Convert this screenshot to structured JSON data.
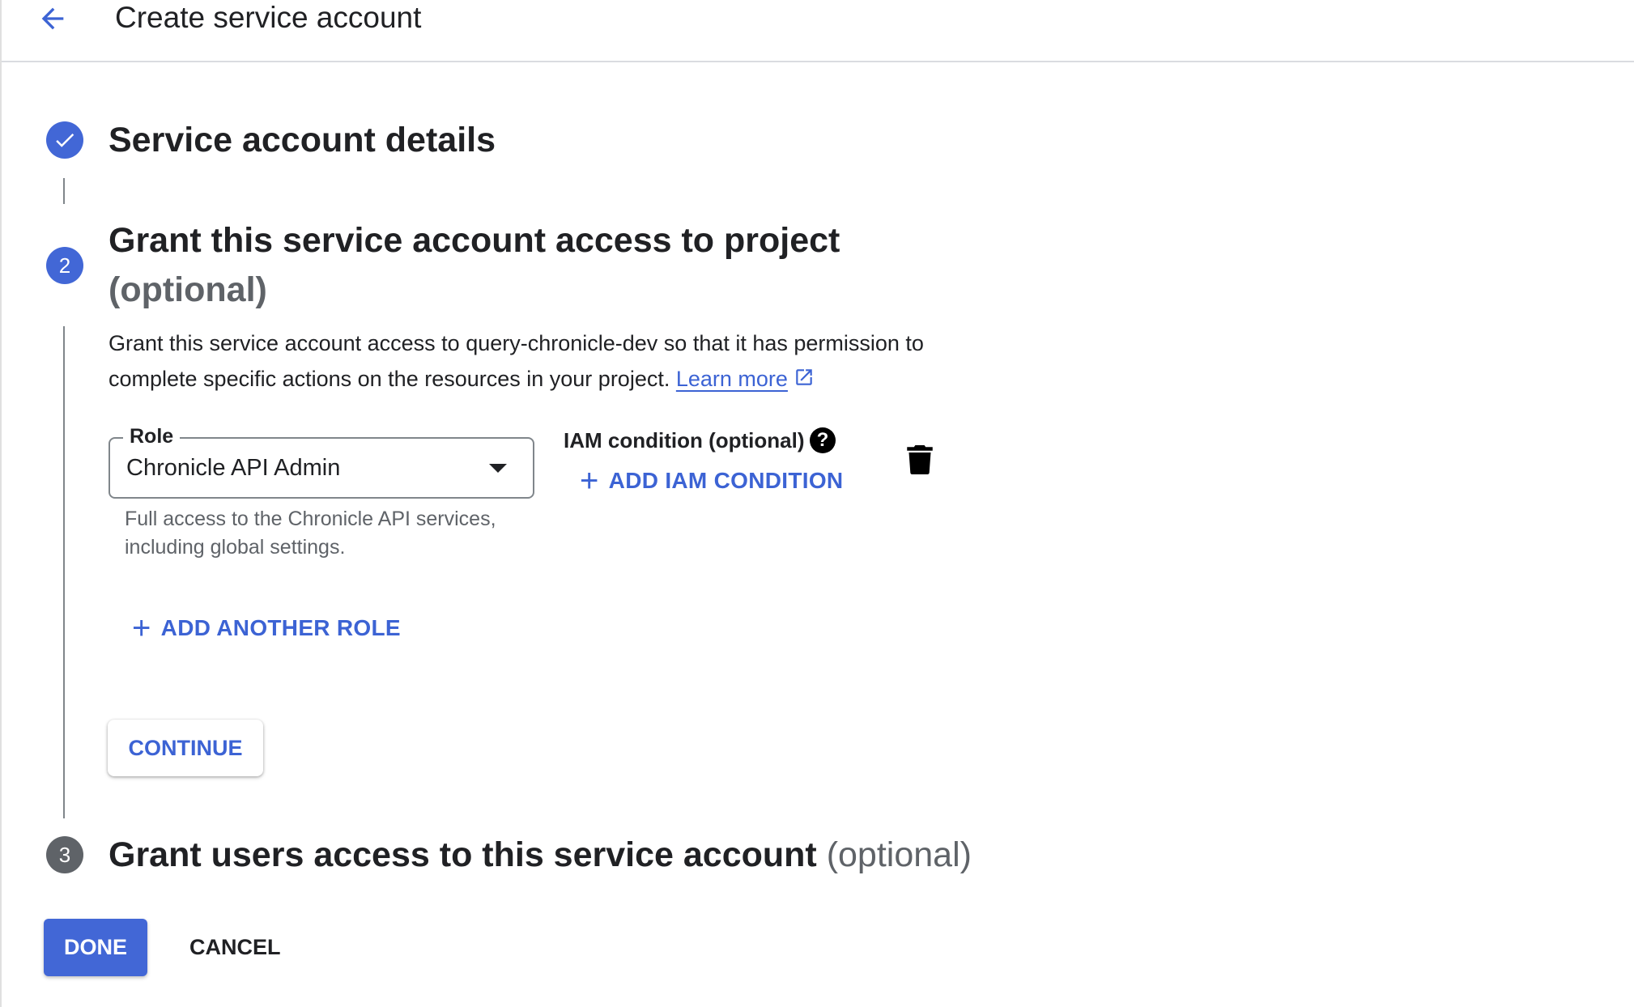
{
  "header": {
    "back_icon": "arrow-back-icon",
    "title": "Create service account"
  },
  "colors": {
    "accent": "#3c63d4",
    "primary_button": "#4267d6",
    "step_complete": "#4267d6",
    "step_active": "#4267d6",
    "step_inactive": "#5f6368",
    "muted_text": "#5f6368"
  },
  "steps": [
    {
      "state": "complete",
      "icon": "check-circle-icon",
      "title": "Service account details"
    },
    {
      "state": "active",
      "number": "2",
      "title": "Grant this service account access to project",
      "optional": "(optional)",
      "description": "Grant this service account access to query-chronicle-dev so that it has permission to complete specific actions on the resources in your project.",
      "learn_more": "Learn more",
      "learn_more_icon": "open-in-new-icon",
      "role": {
        "label": "Role",
        "value": "Chronicle API Admin",
        "hint": "Full access to the Chronicle API services, including global settings."
      },
      "iam_condition": {
        "label": "IAM condition (optional)",
        "help_icon": "help-icon",
        "add_label": "ADD IAM CONDITION"
      },
      "delete_icon": "trash-icon",
      "add_role_label": "ADD ANOTHER ROLE",
      "continue_label": "CONTINUE"
    },
    {
      "state": "inactive",
      "number": "3",
      "title": "Grant users access to this service account",
      "optional": "(optional)"
    }
  ],
  "footer": {
    "done_label": "DONE",
    "cancel_label": "CANCEL"
  }
}
